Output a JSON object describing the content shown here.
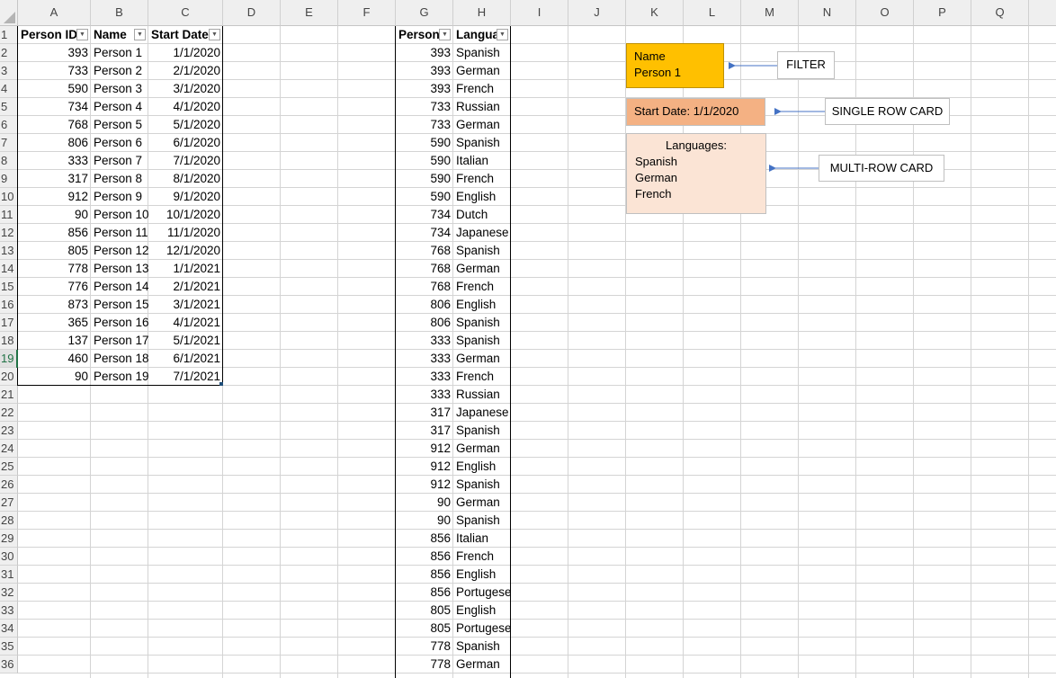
{
  "columns": [
    "A",
    "B",
    "C",
    "D",
    "E",
    "F",
    "G",
    "H",
    "I",
    "J",
    "K",
    "L",
    "M",
    "N",
    "O",
    "P",
    "Q"
  ],
  "rows": [
    "1",
    "2",
    "3",
    "4",
    "5",
    "6",
    "7",
    "8",
    "9",
    "10",
    "11",
    "12",
    "13",
    "14",
    "15",
    "16",
    "17",
    "18",
    "19",
    "20",
    "21",
    "22",
    "23",
    "24",
    "25",
    "26",
    "27",
    "28",
    "29",
    "30",
    "31",
    "32",
    "33",
    "34",
    "35",
    "36"
  ],
  "table1": {
    "headers": [
      "Person ID",
      "Name",
      "Start Date"
    ],
    "rows": [
      [
        "393",
        "Person 1",
        "1/1/2020"
      ],
      [
        "733",
        "Person 2",
        "2/1/2020"
      ],
      [
        "590",
        "Person 3",
        "3/1/2020"
      ],
      [
        "734",
        "Person 4",
        "4/1/2020"
      ],
      [
        "768",
        "Person 5",
        "5/1/2020"
      ],
      [
        "806",
        "Person 6",
        "6/1/2020"
      ],
      [
        "333",
        "Person 7",
        "7/1/2020"
      ],
      [
        "317",
        "Person 8",
        "8/1/2020"
      ],
      [
        "912",
        "Person 9",
        "9/1/2020"
      ],
      [
        "90",
        "Person 10",
        "10/1/2020"
      ],
      [
        "856",
        "Person 11",
        "11/1/2020"
      ],
      [
        "805",
        "Person 12",
        "12/1/2020"
      ],
      [
        "778",
        "Person 13",
        "1/1/2021"
      ],
      [
        "776",
        "Person 14",
        "2/1/2021"
      ],
      [
        "873",
        "Person 15",
        "3/1/2021"
      ],
      [
        "365",
        "Person 16",
        "4/1/2021"
      ],
      [
        "137",
        "Person 17",
        "5/1/2021"
      ],
      [
        "460",
        "Person 18",
        "6/1/2021"
      ],
      [
        "90",
        "Person 19",
        "7/1/2021"
      ]
    ]
  },
  "table2": {
    "headers": [
      "Person",
      "Langua"
    ],
    "rows": [
      [
        "393",
        "Spanish"
      ],
      [
        "393",
        "German"
      ],
      [
        "393",
        "French"
      ],
      [
        "733",
        "Russian"
      ],
      [
        "733",
        "German"
      ],
      [
        "590",
        "Spanish"
      ],
      [
        "590",
        "Italian"
      ],
      [
        "590",
        "French"
      ],
      [
        "590",
        "English"
      ],
      [
        "734",
        "Dutch"
      ],
      [
        "734",
        "Japanese"
      ],
      [
        "768",
        "Spanish"
      ],
      [
        "768",
        "German"
      ],
      [
        "768",
        "French"
      ],
      [
        "806",
        "English"
      ],
      [
        "806",
        "Spanish"
      ],
      [
        "333",
        "Spanish"
      ],
      [
        "333",
        "German"
      ],
      [
        "333",
        "French"
      ],
      [
        "333",
        "Russian"
      ],
      [
        "317",
        "Japanese"
      ],
      [
        "317",
        "Spanish"
      ],
      [
        "912",
        "German"
      ],
      [
        "912",
        "English"
      ],
      [
        "912",
        "Spanish"
      ],
      [
        "90",
        "German"
      ],
      [
        "90",
        "Spanish"
      ],
      [
        "856",
        "Italian"
      ],
      [
        "856",
        "French"
      ],
      [
        "856",
        "English"
      ],
      [
        "856",
        "Portugese"
      ],
      [
        "805",
        "English"
      ],
      [
        "805",
        "Portugese"
      ],
      [
        "778",
        "Spanish"
      ],
      [
        "778",
        "German"
      ]
    ]
  },
  "filter_box": {
    "line1": "Name",
    "line2": "Person 1",
    "color": "#ffc000"
  },
  "single_card": {
    "text": "Start Date: 1/1/2020",
    "color": "#f4b183"
  },
  "multi_card": {
    "title": "Languages:",
    "items": [
      "Spanish",
      "German",
      "French"
    ],
    "color": "#fbe4d5"
  },
  "callouts": {
    "filter": "FILTER",
    "single": "SINGLE ROW CARD",
    "multi": "MULTI-ROW CARD"
  },
  "active_row": "19",
  "colors": {
    "grid": "#d4d4d4",
    "header_bg": "#efefef",
    "arrow": "#4472c4",
    "active": "#217346"
  }
}
